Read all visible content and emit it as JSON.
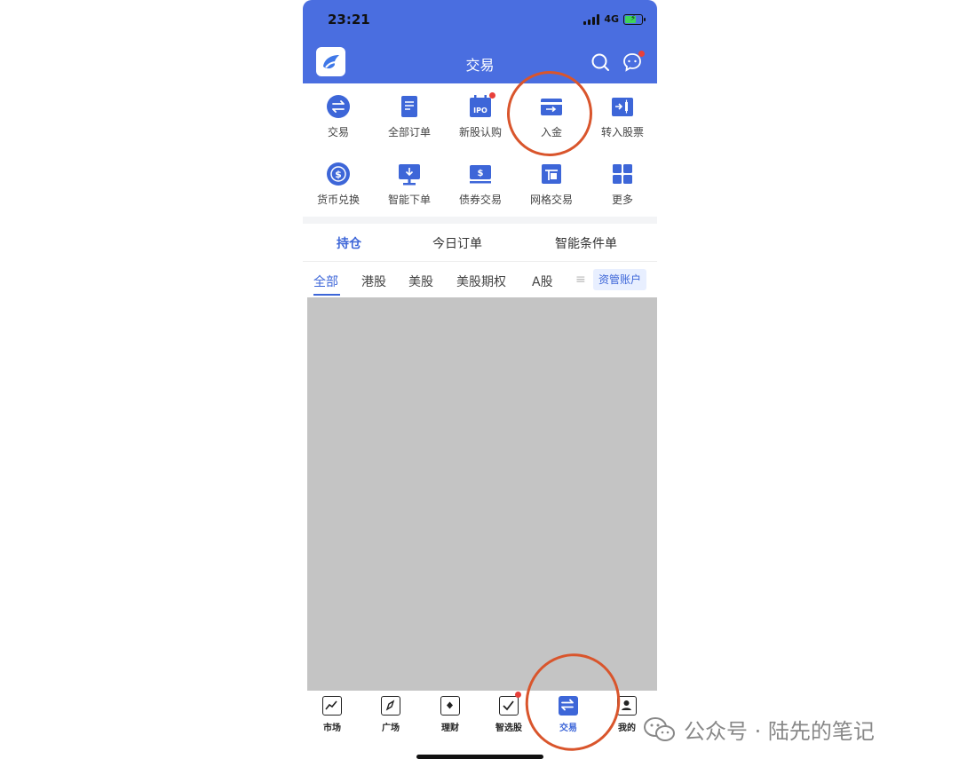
{
  "status_bar": {
    "time": "23:21",
    "network": "4G"
  },
  "header": {
    "title": "交易"
  },
  "quick_actions": [
    {
      "label": "交易",
      "icon": "swap-circle-icon"
    },
    {
      "label": "全部订单",
      "icon": "document-icon"
    },
    {
      "label": "新股认购",
      "icon": "ipo-calendar-icon",
      "badge": true
    },
    {
      "label": "入金",
      "icon": "deposit-card-icon"
    },
    {
      "label": "转入股票",
      "icon": "transfer-in-stock-icon"
    },
    {
      "label": "货币兑换",
      "icon": "currency-exchange-icon"
    },
    {
      "label": "智能下单",
      "icon": "smart-order-monitor-icon"
    },
    {
      "label": "债券交易",
      "icon": "bond-ticket-icon"
    },
    {
      "label": "网格交易",
      "icon": "grid-trading-icon"
    },
    {
      "label": "更多",
      "icon": "more-grid-icon"
    }
  ],
  "tabs": [
    "持仓",
    "今日订单",
    "智能条件单"
  ],
  "active_tab": "持仓",
  "market_filters": [
    "全部",
    "港股",
    "美股",
    "美股期权",
    "A股"
  ],
  "active_filter": "全部",
  "account_button": "资管账户",
  "bottom_nav": [
    {
      "label": "市场",
      "icon": "line-chart-icon"
    },
    {
      "label": "广场",
      "icon": "compass-icon"
    },
    {
      "label": "理财",
      "icon": "diamond-icon"
    },
    {
      "label": "智选股",
      "icon": "checklist-icon",
      "badge": true
    },
    {
      "label": "交易",
      "icon": "trade-swap-icon",
      "active": true
    },
    {
      "label": "我的",
      "icon": "profile-icon"
    }
  ],
  "watermark": {
    "text": "公众号 · 陆先的笔记"
  },
  "colors": {
    "brand_blue": "#4a6ee0",
    "active_blue": "#3d66d8",
    "badge_red": "#e8403a",
    "annotation": "#d9552c"
  }
}
